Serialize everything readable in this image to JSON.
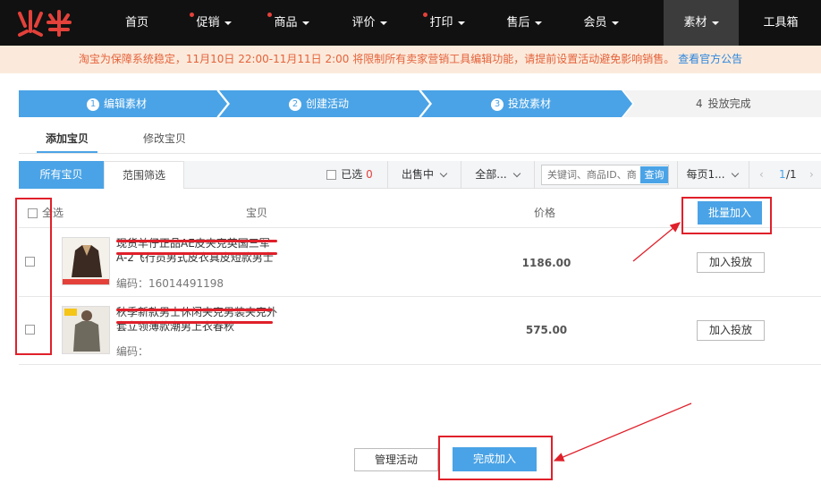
{
  "brand": {
    "logo_text": "火牛",
    "accent": "#e3413a"
  },
  "nav": {
    "items": [
      {
        "label": "首页",
        "dot": false,
        "caret": false
      },
      {
        "label": "促销",
        "dot": true,
        "caret": true
      },
      {
        "label": "商品",
        "dot": true,
        "caret": true
      },
      {
        "label": "评价",
        "dot": false,
        "caret": true
      },
      {
        "label": "打印",
        "dot": true,
        "caret": true
      },
      {
        "label": "售后",
        "dot": false,
        "caret": true
      },
      {
        "label": "会员",
        "dot": false,
        "caret": true
      },
      {
        "label": "素材",
        "dot": false,
        "caret": true,
        "active": true
      },
      {
        "label": "工具箱",
        "dot": false,
        "caret": false
      }
    ]
  },
  "notice": {
    "text": "淘宝为保障系统稳定，11月10日 22:00-11月11日 2:00 将限制所有卖家营销工具编辑功能，请提前设置活动避免影响销售。",
    "link": "查看官方公告"
  },
  "steps": [
    {
      "num": "1",
      "label": "编辑素材"
    },
    {
      "num": "2",
      "label": "创建活动"
    },
    {
      "num": "3",
      "label": "投放素材"
    },
    {
      "num": "4",
      "label": "投放完成"
    }
  ],
  "tabs": {
    "add": "添加宝贝",
    "edit": "修改宝贝"
  },
  "filter": {
    "all": "所有宝贝",
    "range": "范围筛选",
    "selected_label": "已选",
    "selected_count": "0",
    "status": "出售中",
    "category": "全部...",
    "search_placeholder": "关键词、商品ID、商",
    "search_btn": "查询",
    "per_page": "每页1...",
    "page": "1",
    "total": "/1"
  },
  "table": {
    "select_all": "全选",
    "col_item": "宝贝",
    "col_price": "价格",
    "batch_add": "批量加入",
    "rows": [
      {
        "title": "现货羊仔正品AE皮夹克英国三军A-2飞行员男式皮衣真皮短款男士",
        "code_label": "编码：",
        "code": "16014491198",
        "price": "1186.00",
        "action": "加入投放"
      },
      {
        "title": "秋季新款男士休闲夹克男装夹克外套立领薄款潮男上衣春秋",
        "code_label": "编码：",
        "code": "",
        "price": "575.00",
        "action": "加入投放"
      }
    ]
  },
  "footer": {
    "manage": "管理活动",
    "finish": "完成加入"
  }
}
